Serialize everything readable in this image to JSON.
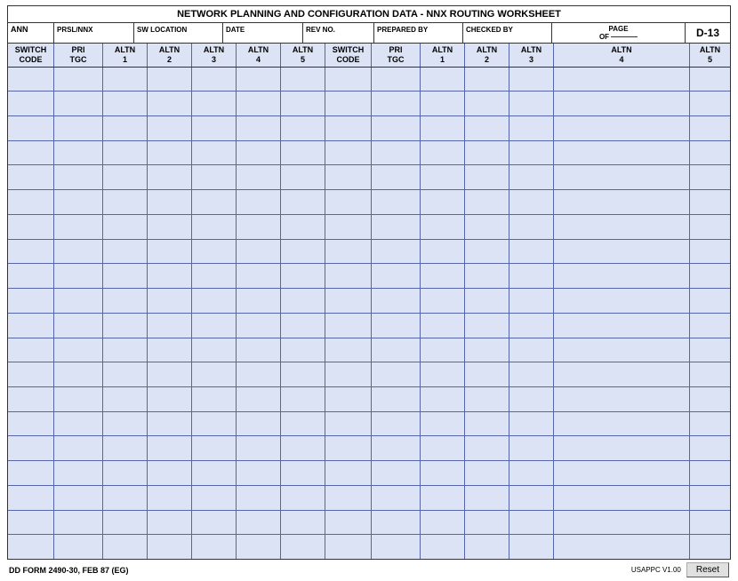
{
  "title": "NETWORK PLANNING AND CONFIGURATION DATA - NNX ROUTING WORKSHEET",
  "header": {
    "ann_label": "ANN",
    "prsl_label": "PRSL/NNX",
    "swloc_label": "SW LOCATION",
    "date_label": "DATE",
    "revno_label": "REV NO.",
    "prepby_label": "PREPARED BY",
    "chkby_label": "CHECKED BY",
    "page_label": "PAGE",
    "of_label": "OF",
    "form_id": "D-13"
  },
  "columns": [
    {
      "id": "switch-code-1",
      "label": "SWITCH\nCODE",
      "lines": 2
    },
    {
      "id": "pri-tgc-1",
      "label": "PRI\nTGC",
      "lines": 2
    },
    {
      "id": "altn-1-1",
      "label": "ALTN\n1",
      "lines": 2
    },
    {
      "id": "altn-2-1",
      "label": "ALTN\n2",
      "lines": 2
    },
    {
      "id": "altn-3-1",
      "label": "ALTN\n3",
      "lines": 2
    },
    {
      "id": "altn-4-1",
      "label": "ALTN\n4",
      "lines": 2
    },
    {
      "id": "altn-5-1",
      "label": "ALTN\n5",
      "lines": 2
    },
    {
      "id": "switch-code-2",
      "label": "SWITCH\nCODE",
      "lines": 2
    },
    {
      "id": "pri-tgc-2",
      "label": "PRI\nTGC",
      "lines": 2
    },
    {
      "id": "altn-1-2",
      "label": "ALTN\n1",
      "lines": 2
    },
    {
      "id": "altn-2-2",
      "label": "ALTN\n2",
      "lines": 2
    },
    {
      "id": "altn-3-2",
      "label": "ALTN\n3",
      "lines": 2
    },
    {
      "id": "altn-4-2",
      "label": "ALTN\n4",
      "lines": 2
    },
    {
      "id": "altn-5-2",
      "label": "ALTN\n5",
      "lines": 2
    }
  ],
  "num_data_rows": 20,
  "footer": {
    "form_name": "DD FORM 2490-30, FEB 87 (EG)",
    "version": "USAPPC V1.00",
    "reset_label": "Reset"
  }
}
